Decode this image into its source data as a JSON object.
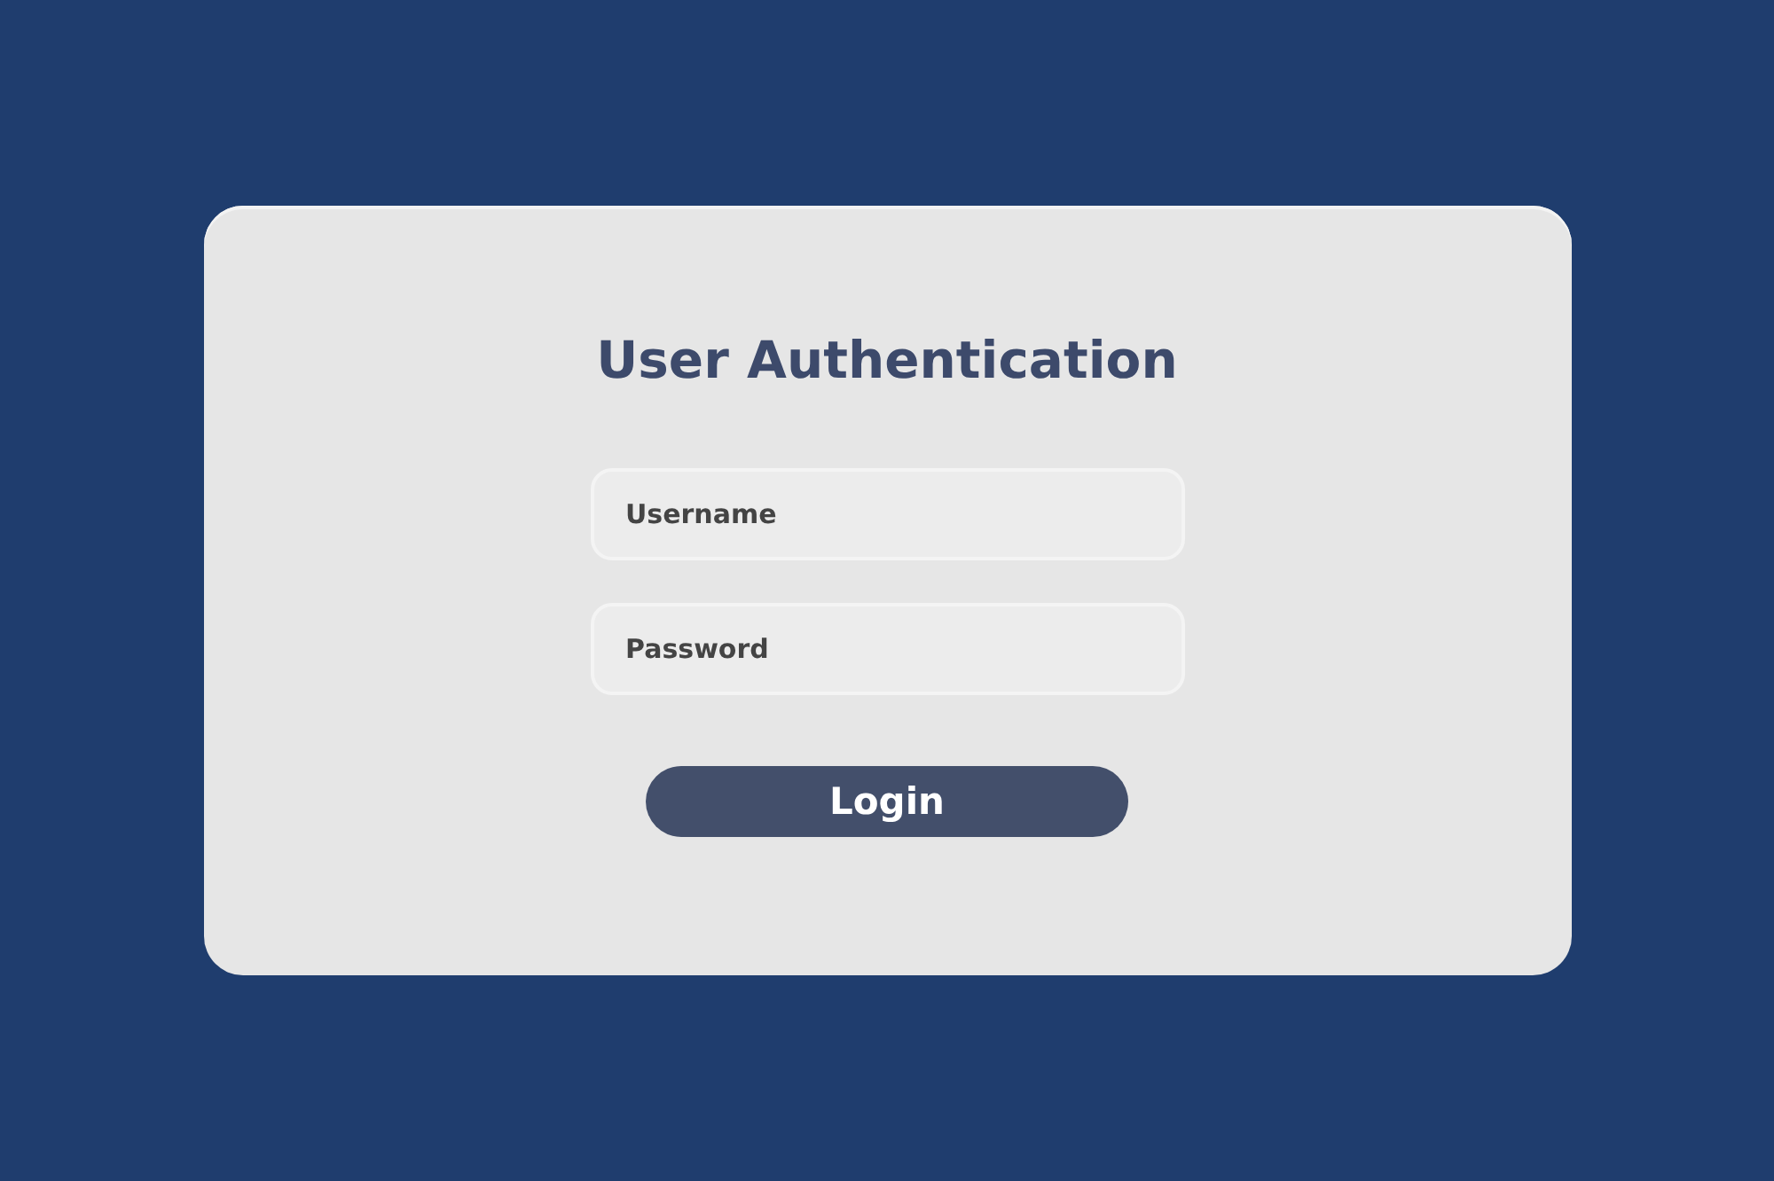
{
  "title": "User Authentication",
  "fields": [
    {
      "placeholder": "Username"
    },
    {
      "placeholder": "Password"
    }
  ],
  "login_button": {
    "label": "Login"
  }
}
